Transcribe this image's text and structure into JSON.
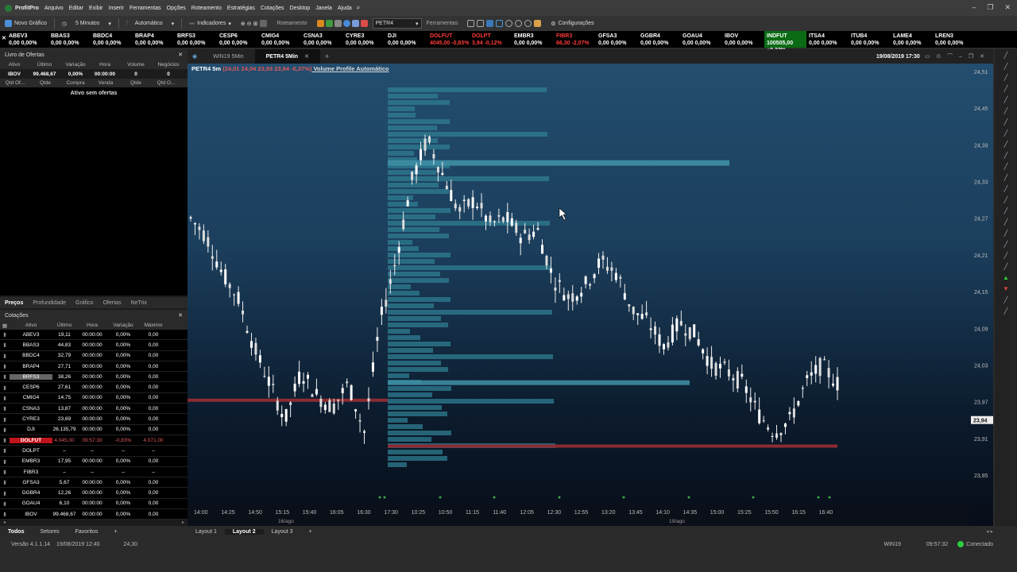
{
  "app": {
    "title": "ProfitPro",
    "menu": [
      "Arquivo",
      "Editar",
      "Exibir",
      "Inserir",
      "Ferramentas",
      "Opções",
      "Roteamento",
      "Estratégias",
      "Cotações",
      "Desktop",
      "Janela",
      "Ajuda"
    ]
  },
  "toolbar": {
    "new_chart": "Novo Gráfico",
    "interval": "5 Minutos",
    "mode": "Automático",
    "indicators": "Indicadores",
    "routing": "Roteamento",
    "symbol": "PETR4",
    "tools": "Ferramentas",
    "settings": "Configurações"
  },
  "ticker": [
    {
      "n": "ABEV3",
      "v": "0,00 0,00%",
      "s": ""
    },
    {
      "n": "BBAS3",
      "v": "0,00 0,00%",
      "s": ""
    },
    {
      "n": "BBDC4",
      "v": "0,00 0,00%",
      "s": ""
    },
    {
      "n": "BRAP4",
      "v": "0,00 0,00%",
      "s": ""
    },
    {
      "n": "BRFS3",
      "v": "0,00 0,00%",
      "s": ""
    },
    {
      "n": "CESP6",
      "v": "0,00 0,00%",
      "s": ""
    },
    {
      "n": "CMIG4",
      "v": "0,00 0,00%",
      "s": ""
    },
    {
      "n": "CSNA3",
      "v": "0,00 0,00%",
      "s": ""
    },
    {
      "n": "CYRE3",
      "v": "0,00 0,00%",
      "s": ""
    },
    {
      "n": "DJI",
      "v": "0,00 0,00%",
      "s": ""
    },
    {
      "n": "DOLFUT",
      "v": "4045,00 -0,83%",
      "s": "red"
    },
    {
      "n": "DOLPT",
      "v": "3,94 -0,12%",
      "s": "red"
    },
    {
      "n": "EMBR3",
      "v": "0,00 0,00%",
      "s": ""
    },
    {
      "n": "FIBR3",
      "v": "66,30 -2,07%",
      "s": "red"
    },
    {
      "n": "GFSA3",
      "v": "0,00 0,00%",
      "s": ""
    },
    {
      "n": "GGBR4",
      "v": "0,00 0,00%",
      "s": ""
    },
    {
      "n": "GOAU4",
      "v": "0,00 0,00%",
      "s": ""
    },
    {
      "n": "IBOV",
      "v": "0,00 0,00%",
      "s": ""
    },
    {
      "n": "INDFUT",
      "v": "100505,00 +0,32%",
      "s": "grn"
    },
    {
      "n": "ITSA4",
      "v": "0,00 0,00%",
      "s": ""
    },
    {
      "n": "ITUB4",
      "v": "0,00 0,00%",
      "s": ""
    },
    {
      "n": "LAME4",
      "v": "0,00 0,00%",
      "s": ""
    },
    {
      "n": "LREN3",
      "v": "0,00 0,00%",
      "s": ""
    }
  ],
  "book": {
    "title": "Livro de Ofertas",
    "headers": [
      "Ativo",
      "Último",
      "Variação",
      "Hora",
      "Volume",
      "Negócios"
    ],
    "row": [
      "IBOV",
      "99.468,67",
      "0,00%",
      "00:00:00",
      "0",
      "0"
    ],
    "headers2": [
      "Qtd Of...",
      "Qtde",
      "Compra",
      "Venda",
      "Qtde",
      "Qtd O..."
    ],
    "empty": "Ativo sem ofertas",
    "tabs": [
      "Preços",
      "Profundidade",
      "Gráfico",
      "Ofertas",
      "NeTrix"
    ]
  },
  "quotes": {
    "title": "Cotações",
    "headers": [
      "Ativo",
      "Último",
      "Hora",
      "Variação",
      "Máximo"
    ],
    "rows": [
      [
        "ABEV3",
        "19,11",
        "00:00:00",
        "0,00%",
        "0,00"
      ],
      [
        "BBAS3",
        "44,83",
        "00:00:00",
        "0,00%",
        "0,00"
      ],
      [
        "BBDC4",
        "32,79",
        "00:00:00",
        "0,00%",
        "0,00"
      ],
      [
        "BRAP4",
        "27,71",
        "00:00:00",
        "0,00%",
        "0,00"
      ],
      [
        "BRFS3",
        "38,26",
        "00:00:00",
        "0,00%",
        "0,00"
      ],
      [
        "CESP6",
        "27,61",
        "00:00:00",
        "0,00%",
        "0,00"
      ],
      [
        "CMIG4",
        "14,75",
        "00:00:00",
        "0,00%",
        "0,00"
      ],
      [
        "CSNA3",
        "13,87",
        "00:00:00",
        "0,00%",
        "0,00"
      ],
      [
        "CYRE3",
        "23,69",
        "00:00:00",
        "0,00%",
        "0,00"
      ],
      [
        "DJI",
        "26.135,79",
        "00:00:00",
        "0,00%",
        "0,00"
      ],
      [
        "DOLFUT",
        "4.045,00",
        "09:57:30",
        "-0,83%",
        "4.071,00"
      ],
      [
        "DOLPT",
        "–",
        "–",
        "–",
        "–"
      ],
      [
        "EMBR3",
        "17,95",
        "00:00:00",
        "0,00%",
        "0,00"
      ],
      [
        "FIBR3",
        "–",
        "–",
        "–",
        "–"
      ],
      [
        "GFSA3",
        "5,67",
        "00:00:00",
        "0,00%",
        "0,00"
      ],
      [
        "GGBR4",
        "12,26",
        "00:00:00",
        "0,00%",
        "0,00"
      ],
      [
        "GOAU4",
        "6,10",
        "00:00:00",
        "0,00%",
        "0,00"
      ],
      [
        "IBOV",
        "99.468,67",
        "00:00:00",
        "0,00%",
        "0,00"
      ]
    ],
    "tabs": [
      "Todos",
      "Setores",
      "Favoritos"
    ]
  },
  "chart_tabs": [
    "WIN19 5Min",
    "PETR4 5Min"
  ],
  "chart_header": {
    "symbol": "PETR4 5m",
    "ohlc": "(24,01  24,04  23,93  23,94  -0,37%)",
    "study": " Volume Profile Automático",
    "datetime": "19/08/2019 17:30"
  },
  "chart_data": {
    "type": "candlestick",
    "ylim": [
      23.85,
      24.51
    ],
    "yticks": [
      "24,51",
      "24,45",
      "24,39",
      "24,33",
      "24,27",
      "24,21",
      "24,15",
      "24,09",
      "24,03",
      "23,97",
      "23,91",
      "23,85"
    ],
    "xticks": [
      "14:00",
      "14:25",
      "14:50",
      "15:15",
      "15:40",
      "16:05",
      "16:30",
      "17:30",
      "10:25",
      "10:50",
      "11:15",
      "11:40",
      "12:05",
      "12:30",
      "12:55",
      "13:20",
      "13:45",
      "14:10",
      "14:35",
      "15:00",
      "15:25",
      "15:50",
      "16:15",
      "16:40"
    ],
    "day_labels": [
      "16/ago",
      "19/ago"
    ],
    "last_price": "23,94"
  },
  "layouts": [
    "Layout 1",
    "Layout 2",
    "Layout 3"
  ],
  "status": {
    "version": "Versão 4.1.1.14",
    "date": "19/08/2019 12:40",
    "value": "24,30",
    "asset": "WIN19",
    "time": "09:57:32",
    "conn": "Conectado"
  }
}
